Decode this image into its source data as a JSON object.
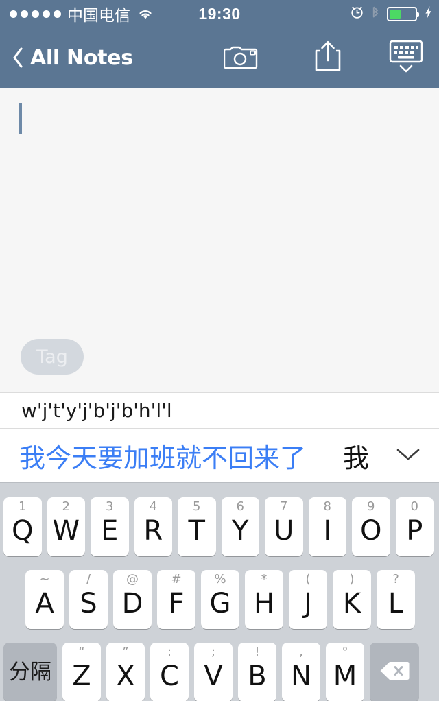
{
  "status_bar": {
    "signal_dots": 5,
    "carrier": "中国电信",
    "wifi_icon": "wifi-icon",
    "time": "19:30",
    "alarm_icon": "alarm-clock-icon",
    "bluetooth_icon": "bluetooth-icon",
    "battery_percent": 45,
    "charging_icon": "lightning-bolt-icon",
    "colors": {
      "bar_bg": "#5b7693",
      "battery_fill": "#4cd964",
      "text": "#ffffff"
    }
  },
  "nav_bar": {
    "back_icon": "chevron-left-icon",
    "back_label": "All Notes",
    "camera_icon": "camera-icon",
    "share_icon": "share-upload-icon",
    "keyboard_hide_icon": "keyboard-dismiss-icon",
    "bg_color": "#5b7693"
  },
  "note": {
    "text": "",
    "caret_visible": true,
    "tag_label": "Tag",
    "bg_color": "#f6f6f6",
    "tag_pill_color": "#d3d8de"
  },
  "ime": {
    "composition": "w'j't'y'j'b'j'b'h'l'l",
    "candidates": [
      {
        "text": "我今天要加班就不回来了",
        "selected": true,
        "color": "#3b7ef5"
      },
      {
        "text": "我",
        "selected": false,
        "color": "#111111"
      }
    ],
    "expand_icon": "chevron-down-icon"
  },
  "keyboard": {
    "bg_color": "#ced2d7",
    "rows": [
      [
        {
          "main": "Q",
          "alt": "1"
        },
        {
          "main": "W",
          "alt": "2"
        },
        {
          "main": "E",
          "alt": "3"
        },
        {
          "main": "R",
          "alt": "4"
        },
        {
          "main": "T",
          "alt": "5"
        },
        {
          "main": "Y",
          "alt": "6"
        },
        {
          "main": "U",
          "alt": "7"
        },
        {
          "main": "I",
          "alt": "8"
        },
        {
          "main": "O",
          "alt": "9"
        },
        {
          "main": "P",
          "alt": "0"
        }
      ],
      [
        {
          "main": "A",
          "alt": "~"
        },
        {
          "main": "S",
          "alt": "/"
        },
        {
          "main": "D",
          "alt": "@"
        },
        {
          "main": "F",
          "alt": "#"
        },
        {
          "main": "G",
          "alt": "%"
        },
        {
          "main": "H",
          "alt": "*"
        },
        {
          "main": "J",
          "alt": "("
        },
        {
          "main": "K",
          "alt": ")"
        },
        {
          "main": "L",
          "alt": "?"
        }
      ],
      [
        {
          "main": "分隔",
          "alt": "",
          "type": "function"
        },
        {
          "main": "Z",
          "alt": "“"
        },
        {
          "main": "X",
          "alt": "”"
        },
        {
          "main": "C",
          "alt": ":"
        },
        {
          "main": "V",
          "alt": ";"
        },
        {
          "main": "B",
          "alt": "!"
        },
        {
          "main": "N",
          "alt": ","
        },
        {
          "main": "M",
          "alt": "°"
        },
        {
          "main": "",
          "alt": "",
          "type": "backspace",
          "icon": "backspace-icon"
        }
      ]
    ]
  }
}
